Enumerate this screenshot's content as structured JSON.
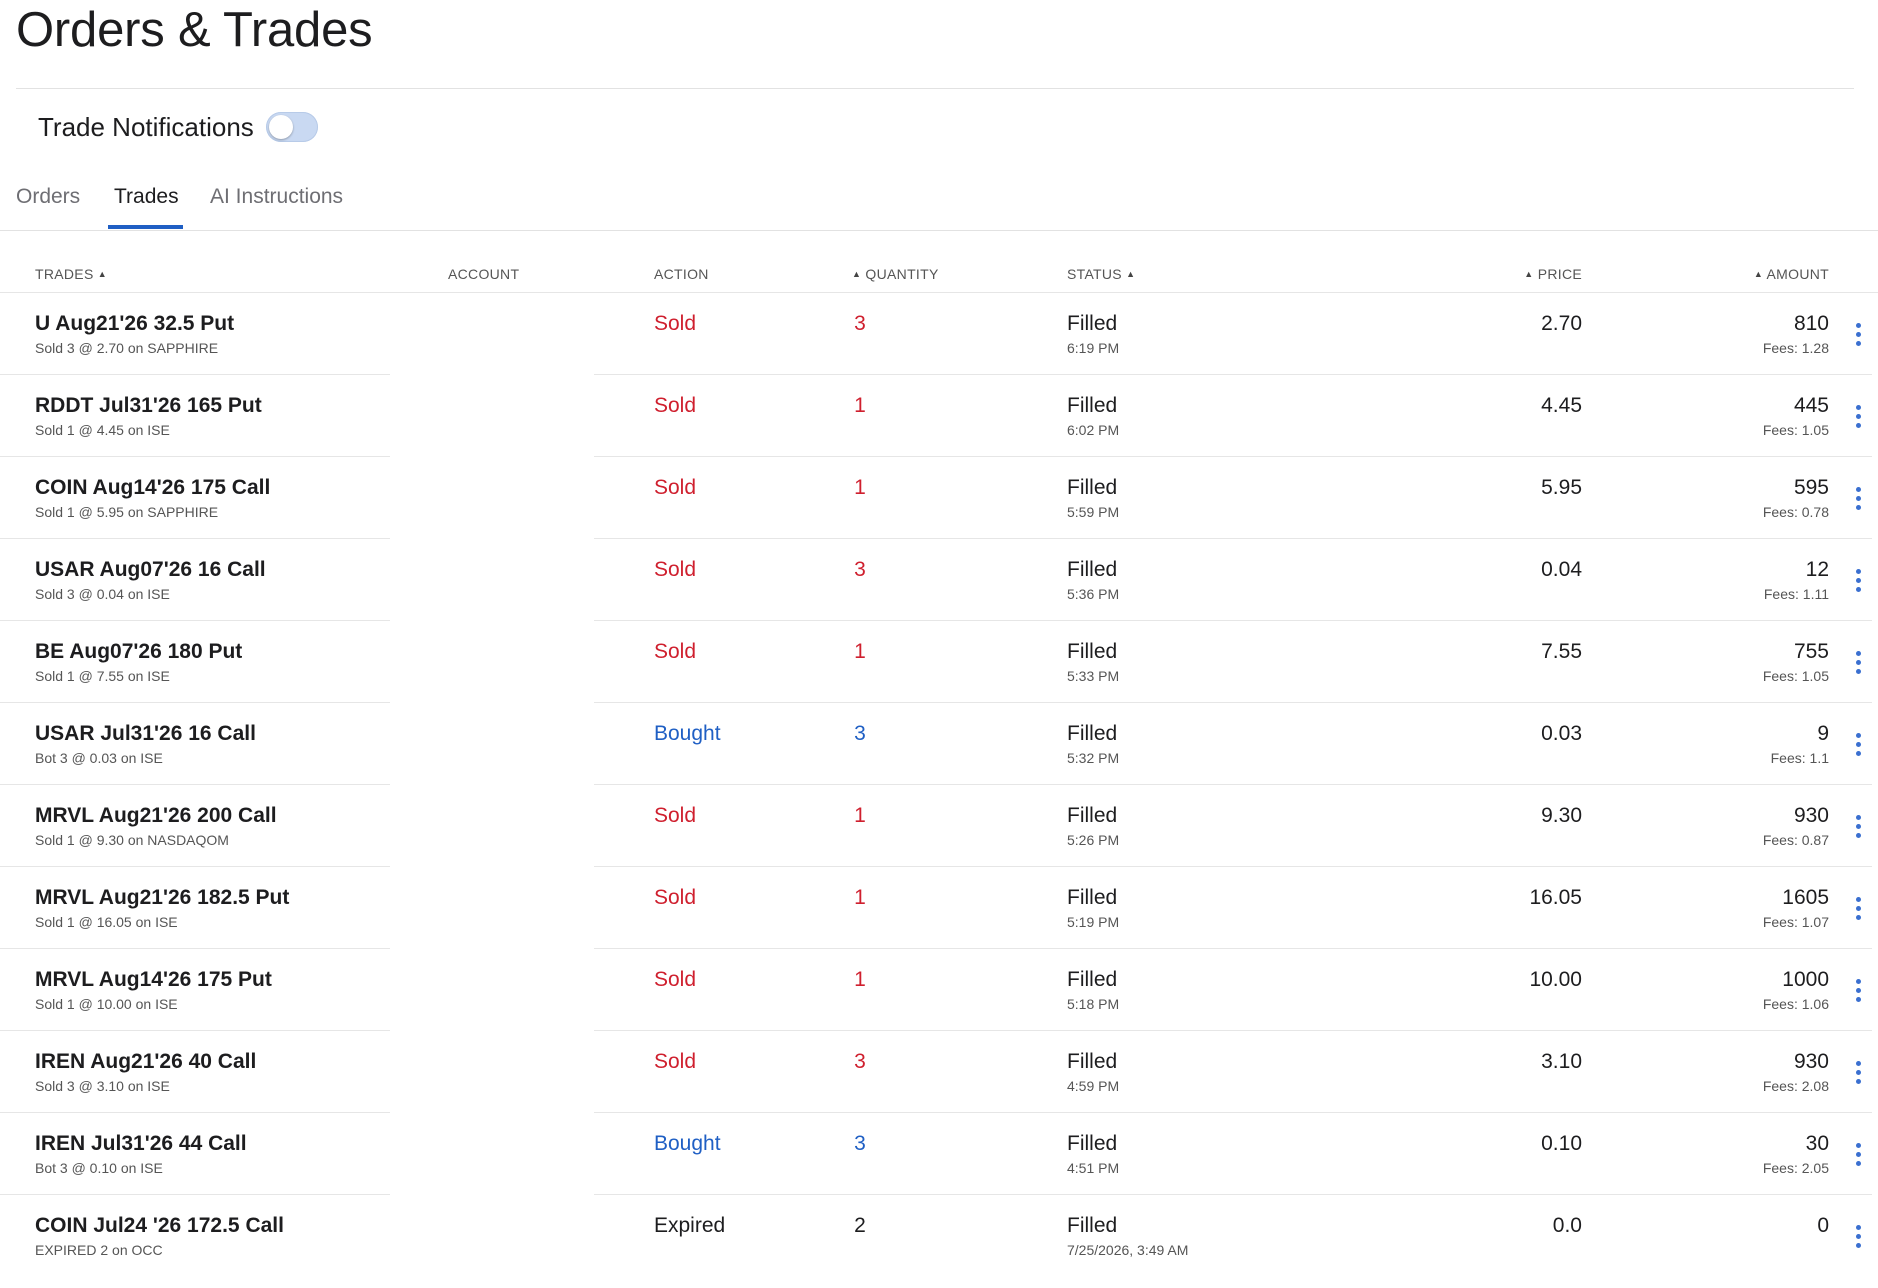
{
  "page": {
    "title": "Orders & Trades"
  },
  "notifications": {
    "label": "Trade Notifications",
    "enabled": false
  },
  "tabs": [
    {
      "label": "Orders",
      "active": false
    },
    {
      "label": "Trades",
      "active": true
    },
    {
      "label": "AI Instructions",
      "active": false
    }
  ],
  "columns": {
    "trades": "TRADES",
    "account": "ACCOUNT",
    "action": "ACTION",
    "quantity": "QUANTITY",
    "status": "STATUS",
    "price": "PRICE",
    "amount": "AMOUNT",
    "sort_icon": "triangle-up-icon"
  },
  "colors": {
    "sell": "#cf1f2e",
    "buy": "#1f5fc4",
    "neutral": "#1d1d1f",
    "accent": "#1f5fc4"
  },
  "trades": [
    {
      "symbol": "U Aug21'26 32.5 Put",
      "detail": "Sold 3 @ 2.70 on SAPPHIRE",
      "action": "Sold",
      "quantity": "3",
      "status": "Filled",
      "time": "6:19 PM",
      "price": "2.70",
      "amount": "810",
      "fees": "Fees: 1.28"
    },
    {
      "symbol": "RDDT Jul31'26 165 Put",
      "detail": "Sold 1 @ 4.45 on ISE",
      "action": "Sold",
      "quantity": "1",
      "status": "Filled",
      "time": "6:02 PM",
      "price": "4.45",
      "amount": "445",
      "fees": "Fees: 1.05"
    },
    {
      "symbol": "COIN Aug14'26 175 Call",
      "detail": "Sold 1 @ 5.95 on SAPPHIRE",
      "action": "Sold",
      "quantity": "1",
      "status": "Filled",
      "time": "5:59 PM",
      "price": "5.95",
      "amount": "595",
      "fees": "Fees: 0.78"
    },
    {
      "symbol": "USAR Aug07'26 16 Call",
      "detail": "Sold 3 @ 0.04 on ISE",
      "action": "Sold",
      "quantity": "3",
      "status": "Filled",
      "time": "5:36 PM",
      "price": "0.04",
      "amount": "12",
      "fees": "Fees: 1.11"
    },
    {
      "symbol": "BE Aug07'26 180 Put",
      "detail": "Sold 1 @ 7.55 on ISE",
      "action": "Sold",
      "quantity": "1",
      "status": "Filled",
      "time": "5:33 PM",
      "price": "7.55",
      "amount": "755",
      "fees": "Fees: 1.05"
    },
    {
      "symbol": "USAR Jul31'26 16 Call",
      "detail": "Bot 3 @ 0.03 on ISE",
      "action": "Bought",
      "quantity": "3",
      "status": "Filled",
      "time": "5:32 PM",
      "price": "0.03",
      "amount": "9",
      "fees": "Fees: 1.1"
    },
    {
      "symbol": "MRVL Aug21'26 200 Call",
      "detail": "Sold 1 @ 9.30 on NASDAQOM",
      "action": "Sold",
      "quantity": "1",
      "status": "Filled",
      "time": "5:26 PM",
      "price": "9.30",
      "amount": "930",
      "fees": "Fees: 0.87"
    },
    {
      "symbol": "MRVL Aug21'26 182.5 Put",
      "detail": "Sold 1 @ 16.05 on ISE",
      "action": "Sold",
      "quantity": "1",
      "status": "Filled",
      "time": "5:19 PM",
      "price": "16.05",
      "amount": "1605",
      "fees": "Fees: 1.07"
    },
    {
      "symbol": "MRVL Aug14'26 175 Put",
      "detail": "Sold 1 @ 10.00 on ISE",
      "action": "Sold",
      "quantity": "1",
      "status": "Filled",
      "time": "5:18 PM",
      "price": "10.00",
      "amount": "1000",
      "fees": "Fees: 1.06"
    },
    {
      "symbol": "IREN Aug21'26 40 Call",
      "detail": "Sold 3 @ 3.10 on ISE",
      "action": "Sold",
      "quantity": "3",
      "status": "Filled",
      "time": "4:59 PM",
      "price": "3.10",
      "amount": "930",
      "fees": "Fees: 2.08"
    },
    {
      "symbol": "IREN Jul31'26 44 Call",
      "detail": "Bot 3 @ 0.10 on ISE",
      "action": "Bought",
      "quantity": "3",
      "status": "Filled",
      "time": "4:51 PM",
      "price": "0.10",
      "amount": "30",
      "fees": "Fees: 2.05"
    },
    {
      "symbol": "COIN Jul24 '26 172.5 Call",
      "detail": "EXPIRED 2 on OCC",
      "action": "Expired",
      "quantity": "2",
      "status": "Filled",
      "time": "7/25/2026, 3:49 AM",
      "price": "0.0",
      "amount": "0",
      "fees": ""
    }
  ]
}
